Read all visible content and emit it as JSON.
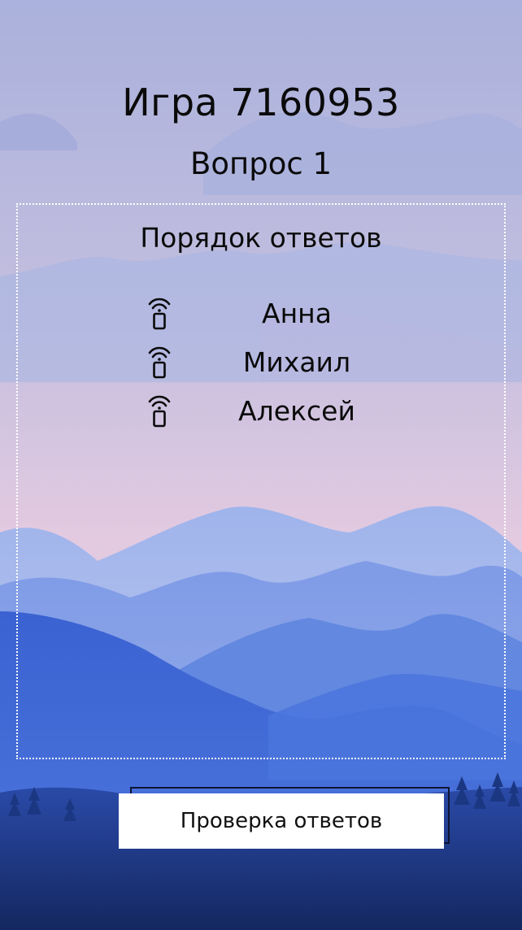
{
  "colors": {
    "sky_top": "#aeb4dd",
    "sky_mid": "#d7c2da",
    "sky_bottom": "#e5cbe0",
    "mountain_far": "#8ea6ea",
    "mountain_mid": "#6c8fe3",
    "mountain_near": "#3f67d4",
    "foreground": "#1c3a8a",
    "text": "#0a0a0a",
    "panel_border": "#ffffff",
    "button_bg": "#ffffff"
  },
  "header": {
    "game_title": "Игра 7160953",
    "question_title": "Вопрос 1"
  },
  "panel": {
    "title": "Порядок ответов",
    "answers": [
      {
        "name": "Анна",
        "icon": "buzzer-signal-icon"
      },
      {
        "name": "Михаил",
        "icon": "buzzer-signal-icon"
      },
      {
        "name": "Алексей",
        "icon": "buzzer-signal-icon"
      }
    ]
  },
  "actions": {
    "check_label": "Проверка ответов"
  }
}
